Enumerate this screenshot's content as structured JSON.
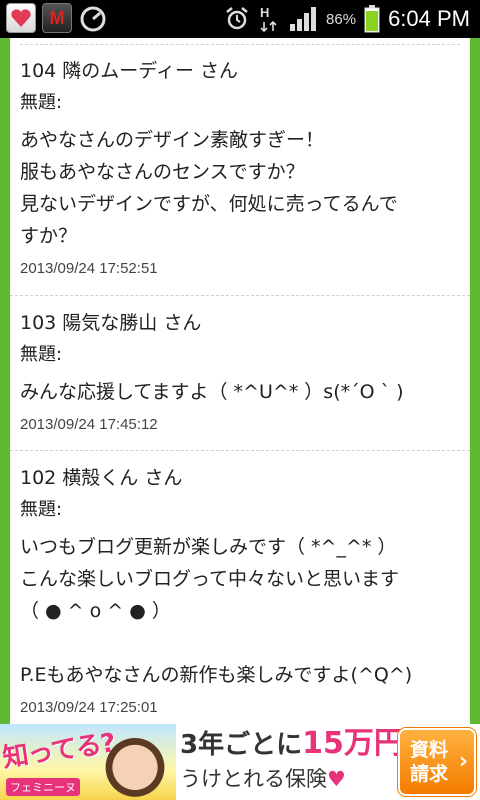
{
  "status_bar": {
    "battery_percent": "86%",
    "time": "6:04 PM",
    "icons": [
      "heart-app-icon",
      "mcafee-icon",
      "gauge-icon",
      "alarm-icon",
      "data-h-icon",
      "signal-icon",
      "battery-icon"
    ],
    "mcafee_glyph": "M",
    "network_type": "H"
  },
  "comments": [
    {
      "header": "104 隣のムーディー さん",
      "title": "無題:",
      "body": "あやなさんのデザイン素敵すぎー！\n服もあやなさんのセンスですか？\n見ないデザインですが、何処に売ってるんで\nすか？",
      "date": "2013/09/24 17:52:51"
    },
    {
      "header": "103 陽気な勝山 さん",
      "title": "無題:",
      "body": "みんな応援してますよ（ *^U^* ）s(*´O ` )",
      "date": "2013/09/24 17:45:12"
    },
    {
      "header": "102 横殻くん さん",
      "title": "無題:",
      "body": "いつもブログ更新が楽しみです（ *^_^* ）\nこんな楽しいブログって中々ないと思います\n（ ● ^ o ^ ● ）\n\nP.Eもあやなさんの新作も楽しみですよ(^Q^)",
      "date": "2013/09/24 17:25:01"
    }
  ],
  "ad": {
    "headline": "知ってる?",
    "brand": "フェミニーヌ",
    "line1_prefix": "3年ごとに",
    "line1_amount": "15万円",
    "line2": "うけとれる保険",
    "heart": "♥",
    "button_line1": "資料",
    "button_line2": "請求",
    "button_arrow": "›"
  }
}
